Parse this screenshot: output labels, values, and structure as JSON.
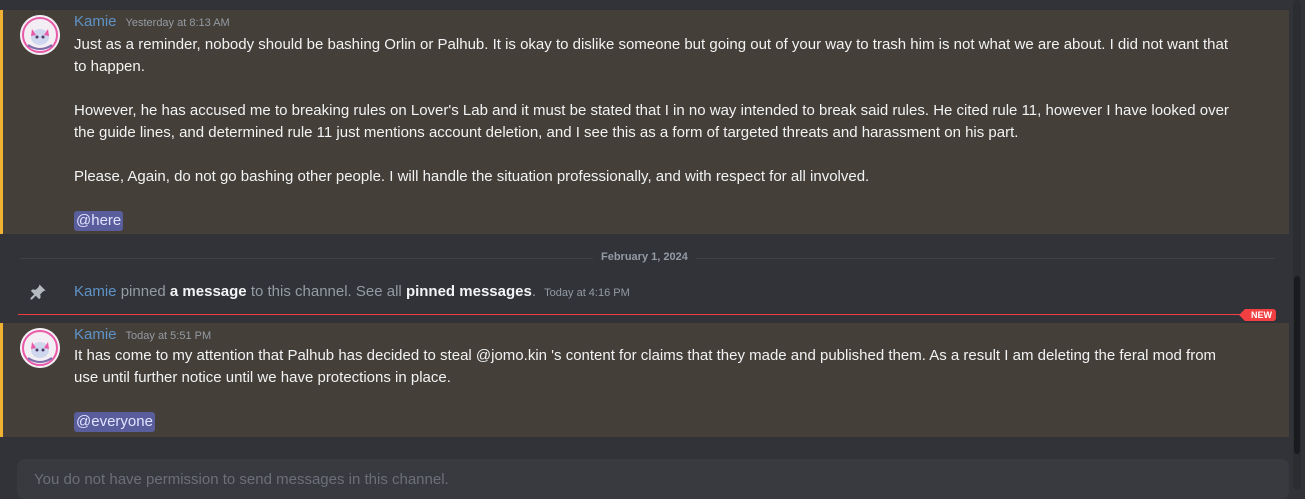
{
  "messages": [
    {
      "author": "Kamie",
      "timestamp": "Yesterday at 8:13 AM",
      "paragraphs": [
        "Just as a reminder, nobody should be bashing Orlin or Palhub. It is okay to dislike someone but going out of your way to trash him is not what we are about. I did not want that to happen.",
        "However, he has accused me to breaking rules on Lover's Lab and it must be stated that I in no way intended to break said rules. He cited rule 11, however I have looked over the guide lines, and determined rule 11 just mentions account deletion, and I see this as a form of targeted threats and harassment on his part.",
        "Please, Again, do not go bashing other people. I will handle the situation professionally, and with respect for all involved."
      ],
      "mention": "@here"
    },
    {
      "author": "Kamie",
      "timestamp": "Today at 5:51 PM",
      "paragraphs": [
        "It has come to my attention that Palhub has decided to steal @jomo.kin 's content for claims that they made and published them. As a result I am deleting the feral mod from use until further notice until we have protections in place."
      ],
      "mention": "@everyone"
    }
  ],
  "date_divider": "February 1, 2024",
  "pin_notice": {
    "author": "Kamie",
    "text1": "pinned",
    "link1": "a message",
    "text2": "to this channel. See all",
    "link2": "pinned messages",
    "text3": ".",
    "timestamp": "Today at 4:16 PM"
  },
  "new_badge": "NEW",
  "input": {
    "placeholder": "You do not have permission to send messages in this channel."
  },
  "colors": {
    "mention_highlight_bg": "#443f38",
    "mention_highlight_border": "#f0b232",
    "author": "#5e93c8",
    "new_marker": "#f23f42"
  },
  "icons": [
    "avatar",
    "pin-icon"
  ]
}
